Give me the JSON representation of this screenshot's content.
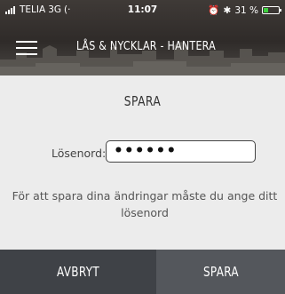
{
  "status_bar": {
    "carrier": "TELIA",
    "network": "3G",
    "time": "11:07",
    "battery_percent": "31 %",
    "battery_level": 0.31,
    "battery_color": "#3ecf3e"
  },
  "header": {
    "title": "LÅS & NYCKLAR - HANTERA",
    "menu_icon": "hamburger-menu-icon"
  },
  "dialog": {
    "heading": "SPARA",
    "password_label": "Lösenord:",
    "password_value": "••••••",
    "info_text": "För att spara dina ändringar måste du ange ditt lösenord"
  },
  "actions": {
    "cancel_label": "AVBRYT",
    "save_label": "SPARA",
    "cancel_color": "#3f4247",
    "save_color": "#54575c"
  }
}
